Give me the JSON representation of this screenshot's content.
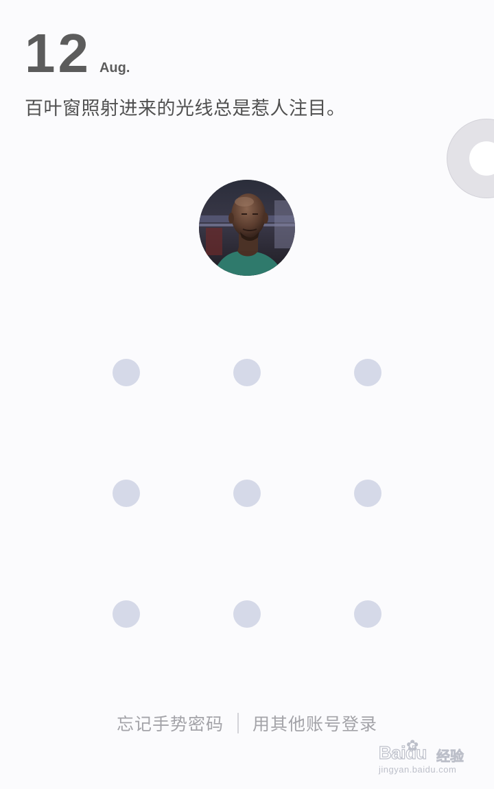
{
  "lockscreen": {
    "date": {
      "day": "12",
      "month": "Aug."
    },
    "quote": "百叶窗照射进来的光线总是惹人注目。",
    "avatar_icon": "user-avatar-photo",
    "pattern": {
      "rows": 3,
      "cols": 3,
      "dot_color": "#d5d9e8"
    },
    "footer": {
      "forgot_pattern": "忘记手势密码",
      "other_account_login": "用其他账号登录"
    }
  },
  "watermark": {
    "brand": "Baidu",
    "suffix": "经验",
    "url": "jingyan.baidu.com"
  },
  "colors": {
    "background": "#fbfbfd",
    "text_primary": "#5c5c5c",
    "text_secondary": "#a3a3a8",
    "handle": "#e3e2e7"
  }
}
